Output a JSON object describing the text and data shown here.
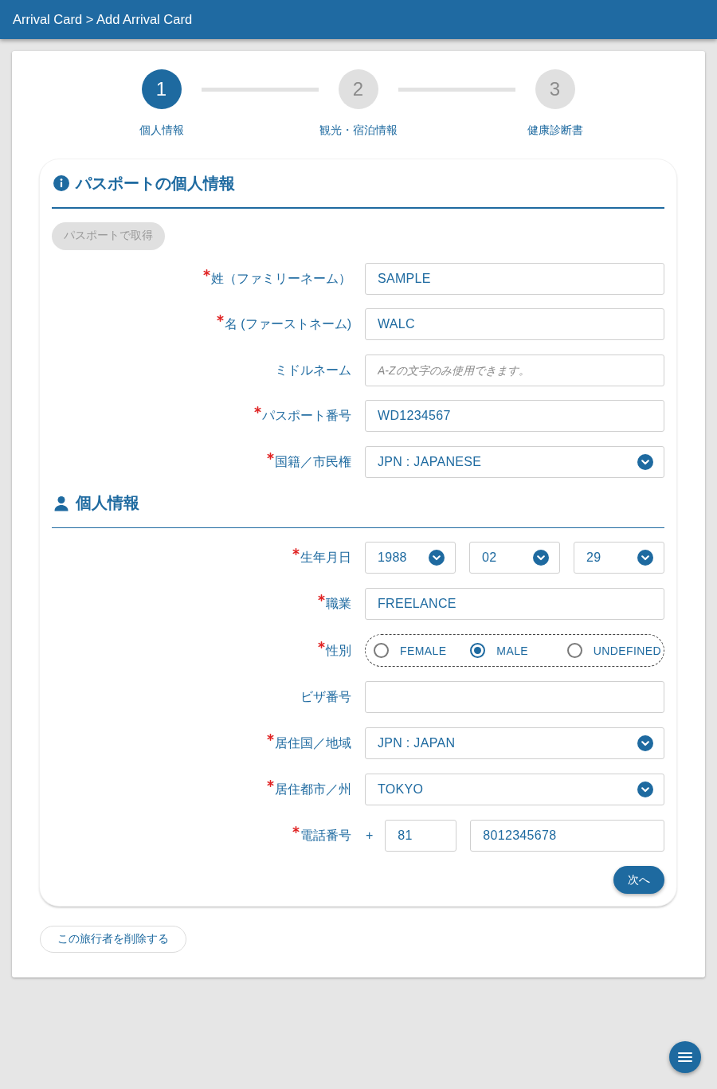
{
  "header": {
    "title": "Arrival Card > Add Arrival Card"
  },
  "steps": [
    {
      "number": "1",
      "label": "個人情報",
      "selected": true
    },
    {
      "number": "2",
      "label": "観光・宿泊情報",
      "selected": false
    },
    {
      "number": "3",
      "label": "健康診断書",
      "selected": false
    }
  ],
  "sections": [
    {
      "kind": "passport",
      "title": "パスポートの個人情報",
      "fetch_button": {
        "label": "パスポートで取得",
        "disabled": true
      },
      "fields": [
        {
          "kind": "text",
          "label": "姓（ファミリーネーム）",
          "required": true,
          "value": "SAMPLE"
        },
        {
          "kind": "text",
          "label": "名 (ファーストネーム)",
          "required": true,
          "value": "WALC"
        },
        {
          "kind": "text",
          "label": "ミドルネーム",
          "required": false,
          "placeholder": "A-Zの文字のみ使用できます。"
        },
        {
          "kind": "text",
          "label": "パスポート番号",
          "required": true,
          "value": "WD1234567"
        },
        {
          "kind": "select",
          "label": "国籍／市民権",
          "required": true,
          "value": "JPN : JAPANESE"
        }
      ]
    },
    {
      "kind": "personal",
      "title": "個人情報",
      "fields": [
        {
          "kind": "date",
          "label": "生年月日",
          "required": true,
          "parts": [
            "1988",
            "02",
            "29"
          ]
        },
        {
          "kind": "text",
          "label": "職業",
          "required": true,
          "value": "FREELANCE"
        },
        {
          "kind": "radio",
          "label": "性別",
          "required": true,
          "options": [
            {
              "label": "FEMALE",
              "selected": false
            },
            {
              "label": "MALE",
              "selected": true
            },
            {
              "label": "UNDEFINED",
              "selected": false
            }
          ]
        },
        {
          "kind": "text",
          "label": "ビザ番号",
          "required": false
        },
        {
          "kind": "select",
          "label": "居住国／地域",
          "required": true,
          "value": "JPN : JAPAN"
        },
        {
          "kind": "select",
          "label": "居住都市／州",
          "required": true,
          "value": "TOKYO"
        },
        {
          "kind": "phone",
          "label": "電話番号",
          "required": true,
          "prefix": "+",
          "country_code": "81",
          "number": "8012345678"
        }
      ]
    }
  ],
  "next_button": {
    "label": "次へ"
  },
  "delete_button": {
    "label": "この旅行者を削除する"
  }
}
